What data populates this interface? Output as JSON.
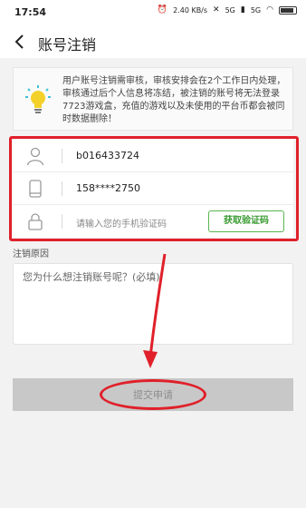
{
  "status_bar": {
    "time": "17:54",
    "speed": "2.40 KB/s",
    "network_1": "5G",
    "network_2": "5G"
  },
  "header": {
    "title": "账号注销"
  },
  "notice": {
    "text": "用户账号注销需审核，审核安排会在2个工作日内处理，审核通过后个人信息将冻结，被注销的账号将无法登录7723游戏盒，充值的游戏以及未使用的平台币都会被同时数据删除！"
  },
  "form": {
    "account": "b016433724",
    "phone": "158****2750",
    "code_placeholder": "请输入您的手机验证码",
    "get_code_label": "获取验证码"
  },
  "reason": {
    "label": "注销原因",
    "placeholder": "您为什么想注销账号呢？(必填)"
  },
  "submit": {
    "label": "提交申请"
  },
  "colors": {
    "accent_green": "#3a9b32",
    "annotation_red": "#e0202a"
  }
}
